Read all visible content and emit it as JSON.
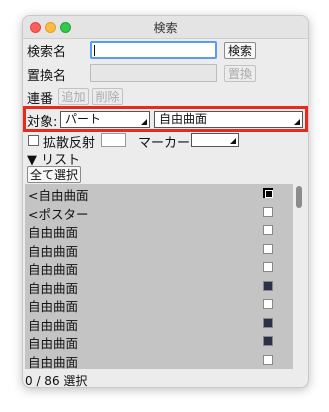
{
  "window": {
    "title": "検索"
  },
  "search": {
    "label": "検索名",
    "value": "",
    "button": "検索"
  },
  "replace": {
    "label": "置換名",
    "value": "",
    "button": "置換"
  },
  "serial": {
    "label": "連番",
    "add_button": "追加",
    "delete_button": "削除"
  },
  "target": {
    "label": "対象:",
    "type_value": "パート",
    "kind_value": "自由曲面"
  },
  "options": {
    "diffuse_label": "拡散反射",
    "marker_label": "マーカー"
  },
  "list_section": {
    "toggle": "▼ リスト",
    "select_all_button": "全て選択"
  },
  "list": [
    {
      "name": "<自由曲面",
      "swatch": "on"
    },
    {
      "name": "<ポスター",
      "swatch": "off"
    },
    {
      "name": "自由曲面",
      "swatch": "off"
    },
    {
      "name": "自由曲面",
      "swatch": "off"
    },
    {
      "name": "自由曲面",
      "swatch": "off"
    },
    {
      "name": "自由曲面",
      "swatch": "mid"
    },
    {
      "name": "自由曲面",
      "swatch": "off"
    },
    {
      "name": "自由曲面",
      "swatch": "mid"
    },
    {
      "name": "自由曲面",
      "swatch": "mid"
    },
    {
      "name": "自由曲面",
      "swatch": "off"
    }
  ],
  "status": {
    "text": "0 / 86 選択"
  }
}
